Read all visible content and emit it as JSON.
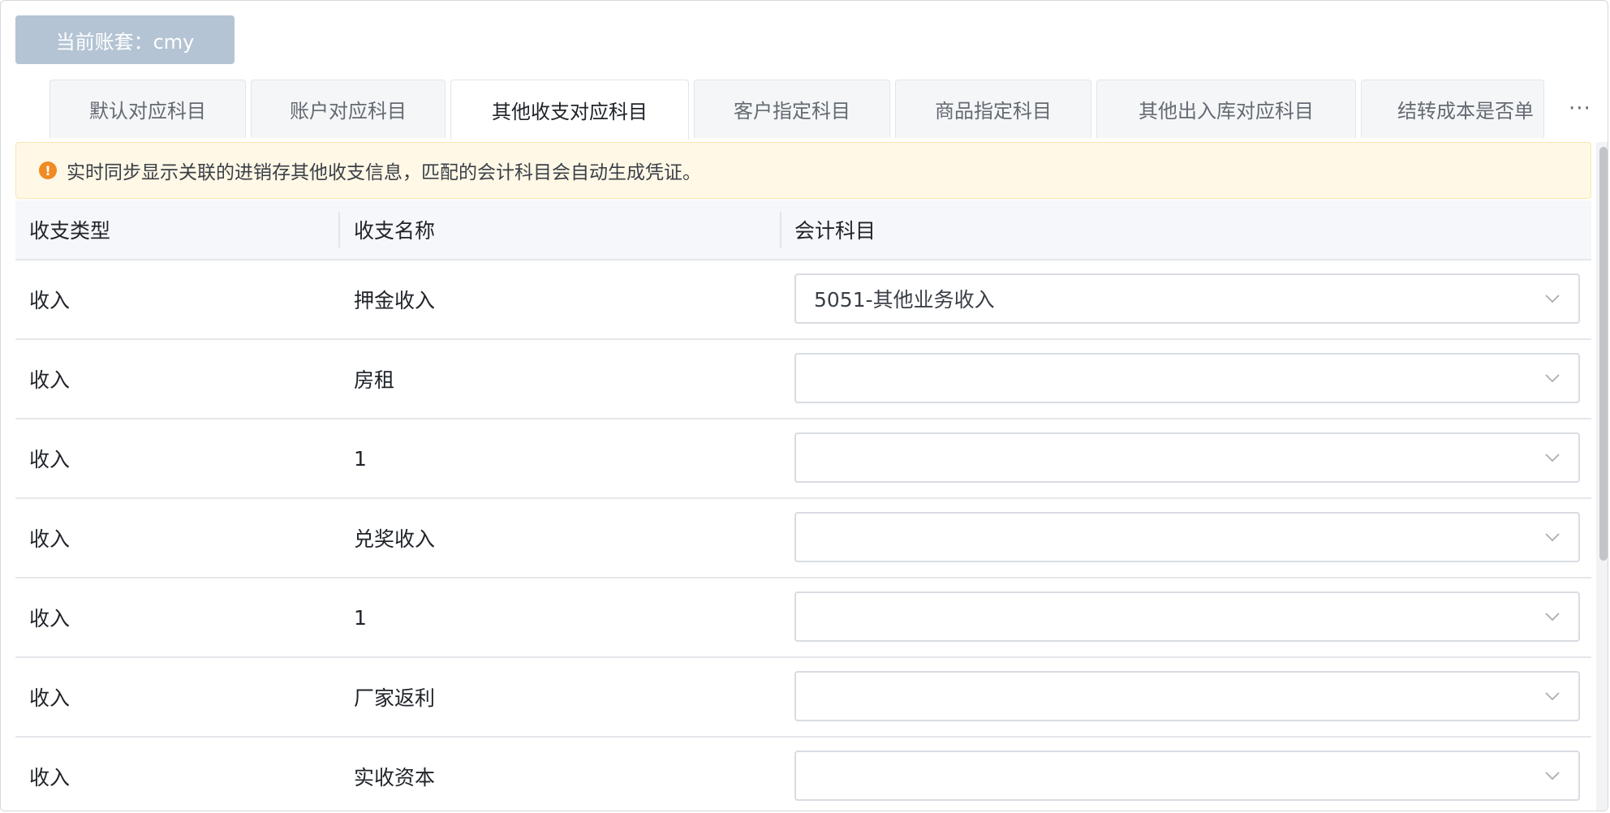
{
  "account_button": {
    "label": "当前账套：cmy"
  },
  "tabs": [
    {
      "label": "默认对应科目",
      "active": false
    },
    {
      "label": "账户对应科目",
      "active": false
    },
    {
      "label": "其他收支对应科目",
      "active": true
    },
    {
      "label": "客户指定科目",
      "active": false
    },
    {
      "label": "商品指定科目",
      "active": false
    },
    {
      "label": "其他出入库对应科目",
      "active": false
    },
    {
      "label": "结转成本是否单",
      "active": false
    }
  ],
  "more_label": "···",
  "alert": {
    "icon": "warning-icon",
    "text": "实时同步显示关联的进销存其他收支信息，匹配的会计科目会自动生成凭证。"
  },
  "table": {
    "headers": [
      "收支类型",
      "收支名称",
      "会计科目"
    ],
    "rows": [
      {
        "type": "收入",
        "name": "押金收入",
        "account": "5051-其他业务收入"
      },
      {
        "type": "收入",
        "name": "房租",
        "account": ""
      },
      {
        "type": "收入",
        "name": "1",
        "account": ""
      },
      {
        "type": "收入",
        "name": "兑奖收入",
        "account": ""
      },
      {
        "type": "收入",
        "name": "1",
        "account": ""
      },
      {
        "type": "收入",
        "name": "厂家返利",
        "account": ""
      },
      {
        "type": "收入",
        "name": "实收资本",
        "account": ""
      }
    ]
  },
  "colors": {
    "account_button_bg": "#b4c4d4",
    "alert_bg": "#fff8e6",
    "alert_icon": "#f08a24",
    "header_bg": "#f5f7fa"
  }
}
